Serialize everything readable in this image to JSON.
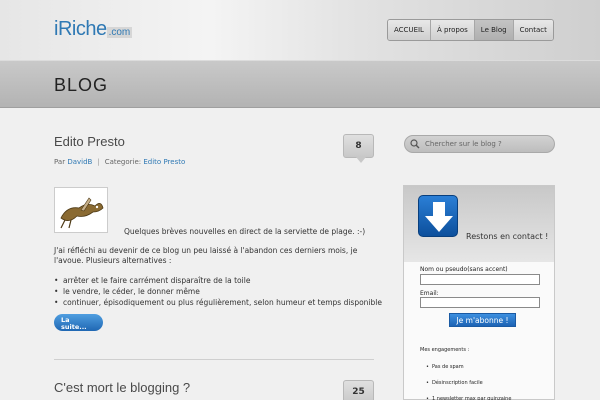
{
  "header": {
    "logo_main": "iRiche",
    "logo_suffix": ".com",
    "nav": [
      {
        "label": "ACCUEIL"
      },
      {
        "label": "À propos"
      },
      {
        "label": "Le Blog"
      },
      {
        "label": "Contact"
      }
    ],
    "active_nav": "Le Blog"
  },
  "band": {
    "title": "BLOG"
  },
  "posts": [
    {
      "title": "Edito Presto",
      "comments": "8",
      "meta": {
        "by_label": "Par",
        "author": "DavidB",
        "category_label": "Categorie:",
        "category": "Edito Presto"
      },
      "intro": "Quelques brèves nouvelles en direct de la serviette de plage. :-)",
      "paragraph": "J'ai réfléchi au devenir de ce blog un peu laissé à l'abandon ces derniers mois, je l'avoue. Plusieurs alternatives :",
      "list": [
        "arrêter et le faire carrément disparaître de la toile",
        "le vendre, le céder, le donner même",
        "continuer, épisodiquement ou plus régulièrement, selon humeur et temps disponible"
      ],
      "more_line1": "La",
      "more_line2": "suite..."
    },
    {
      "title": "C'est mort le blogging ?",
      "comments": "25"
    }
  ],
  "sidebar": {
    "search_placeholder": "Chercher sur le blog ?",
    "widget_title": "Restons en contact !",
    "name_label": "Nom ou pseudo(sans accent)",
    "email_label": "Email:",
    "subscribe_label": "Je m'abonne !",
    "engagements_label": "Mes engagements :",
    "engagements": [
      "Pas de spam",
      "Désinscription facile",
      "1 newsletter max par quinzaine"
    ]
  },
  "colors": {
    "accent": "#2f79b4",
    "button": "#1f67b3"
  }
}
